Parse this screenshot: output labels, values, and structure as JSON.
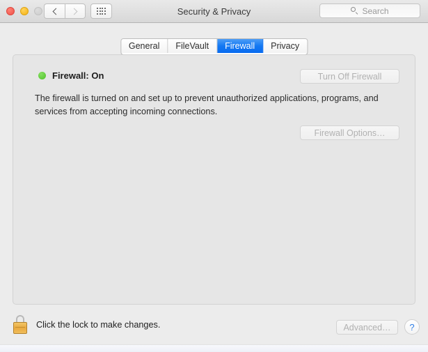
{
  "window": {
    "title": "Security & Privacy",
    "traffic_lights": [
      {
        "name": "close",
        "state": "enabled"
      },
      {
        "name": "minimize",
        "state": "enabled"
      },
      {
        "name": "zoom",
        "state": "disabled"
      }
    ],
    "nav": {
      "back_label": "Back",
      "forward_label": "Forward",
      "show_all_label": "Show All"
    },
    "search": {
      "placeholder": "Search",
      "value": "",
      "icon": "search-icon"
    }
  },
  "tabs": [
    {
      "label": "General",
      "selected": false
    },
    {
      "label": "FileVault",
      "selected": false
    },
    {
      "label": "Firewall",
      "selected": true
    },
    {
      "label": "Privacy",
      "selected": false
    }
  ],
  "panel": {
    "status": {
      "indicator": "green-dot",
      "text": "Firewall: On"
    },
    "description": "The firewall is turned on and set up to prevent unauthorized applications, programs, and services from accepting incoming connections.",
    "turn_off_button": {
      "label": "Turn Off Firewall",
      "enabled": false
    },
    "options_button": {
      "label": "Firewall Options…",
      "enabled": false
    }
  },
  "footer": {
    "lock": {
      "icon": "lock-closed-icon",
      "text": "Click the lock to make changes."
    },
    "advanced_button": {
      "label": "Advanced…",
      "enabled": false
    },
    "help_button": {
      "label": "?"
    }
  },
  "colors": {
    "accent_blue": "#1478f2",
    "status_green": "#4fc12a",
    "window_bg": "#ececec",
    "panel_bg": "#e6e6e6",
    "disabled_text": "#b1b1b1",
    "lock_gold": "#e9a93f",
    "help_blue": "#2f7fe8"
  }
}
